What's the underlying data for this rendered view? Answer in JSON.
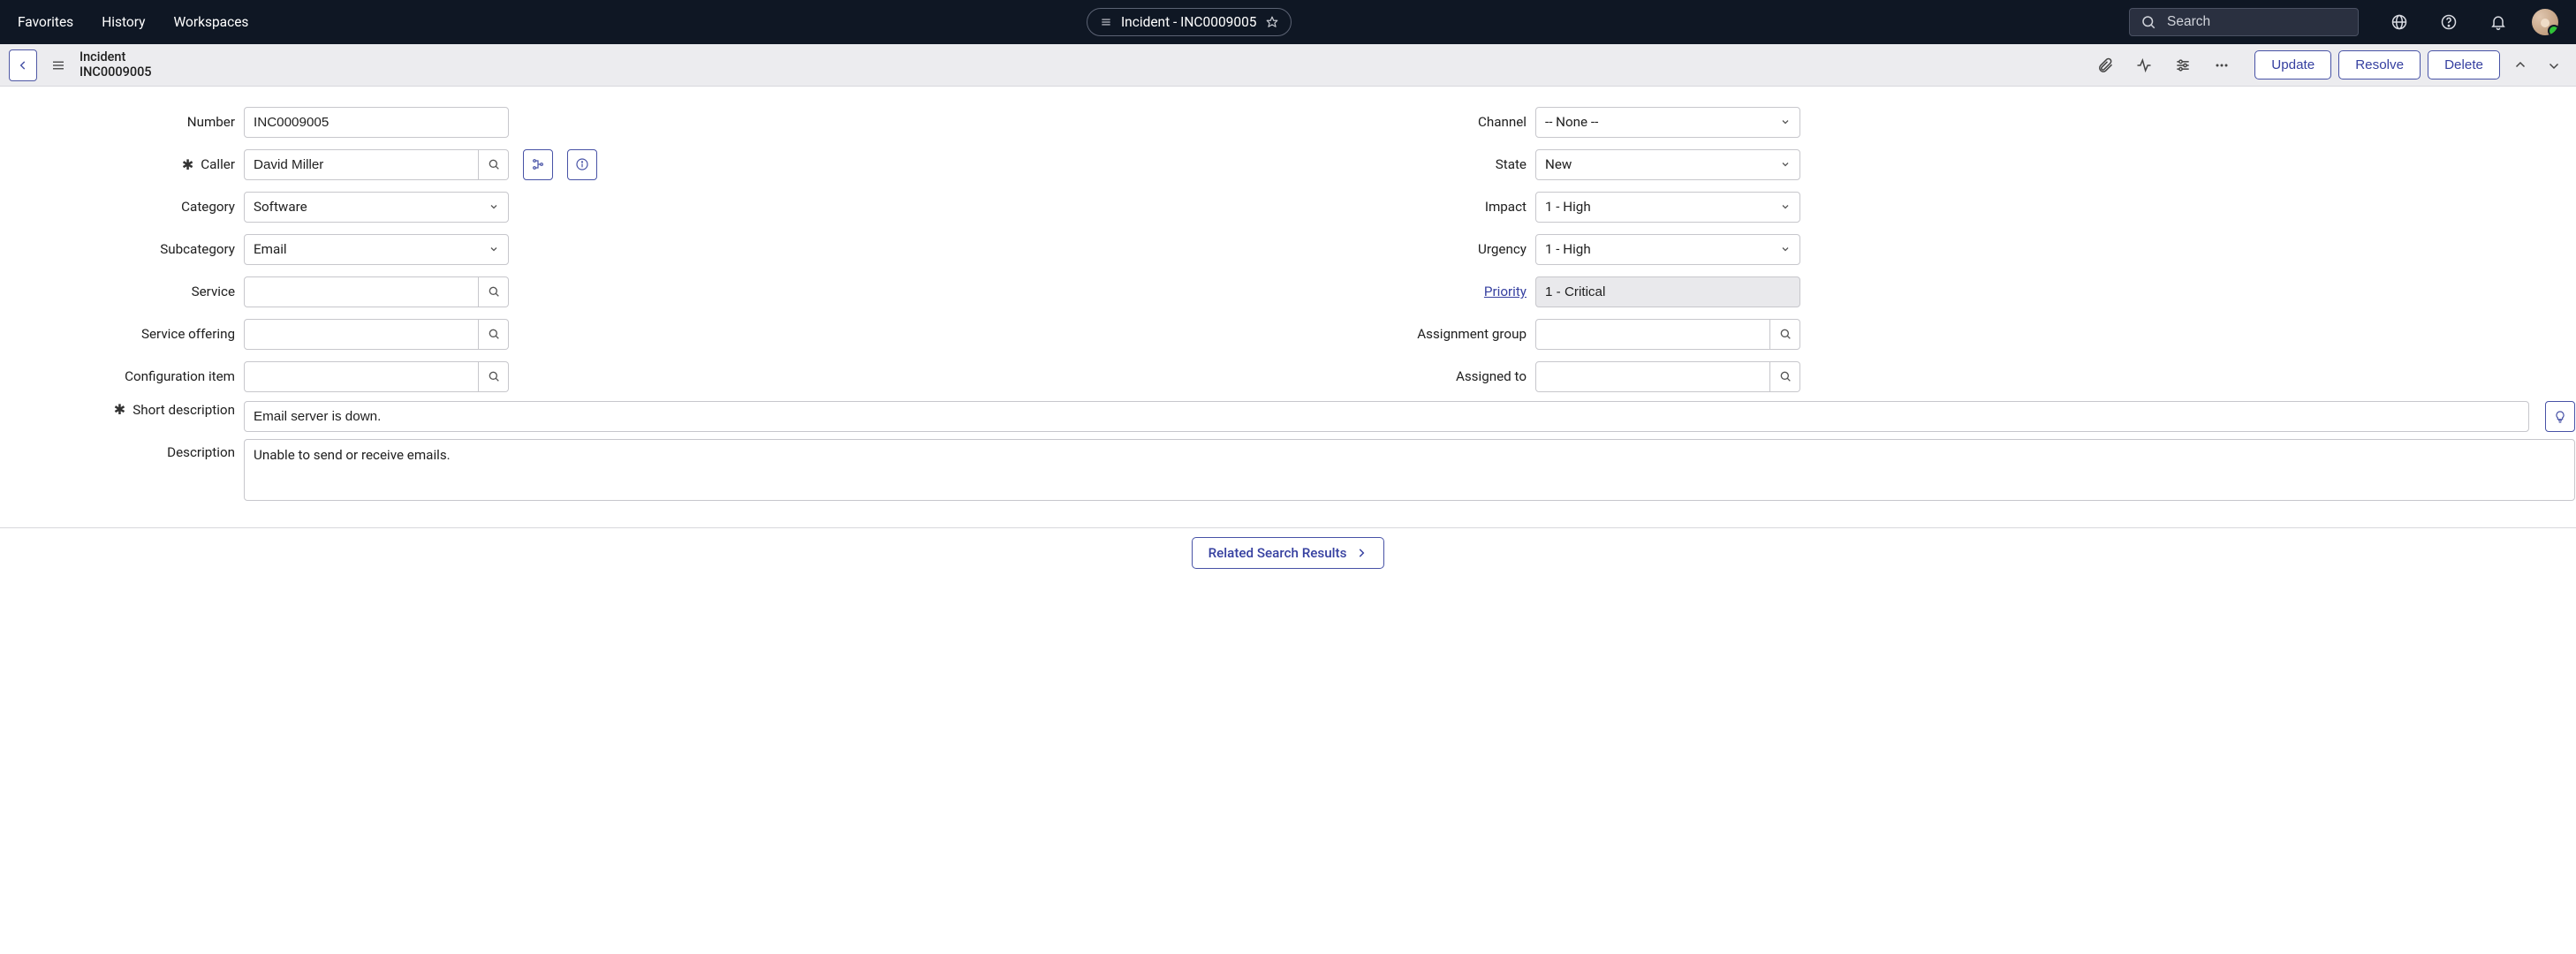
{
  "topnav": {
    "items": [
      "Favorites",
      "History",
      "Workspaces"
    ],
    "title_pill": "Incident - INC0009005",
    "search_placeholder": "Search"
  },
  "subbar": {
    "crumb_type": "Incident",
    "crumb_id": "INC0009005",
    "actions": {
      "update": "Update",
      "resolve": "Resolve",
      "delete": "Delete"
    }
  },
  "form": {
    "labels": {
      "number": "Number",
      "caller": "Caller",
      "category": "Category",
      "subcategory": "Subcategory",
      "service": "Service",
      "service_offering": "Service offering",
      "configuration_item": "Configuration item",
      "channel": "Channel",
      "state": "State",
      "impact": "Impact",
      "urgency": "Urgency",
      "priority": "Priority",
      "assignment_group": "Assignment group",
      "assigned_to": "Assigned to",
      "short_description": "Short description",
      "description": "Description"
    },
    "values": {
      "number": "INC0009005",
      "caller": "David Miller",
      "category": "Software",
      "subcategory": "Email",
      "service": "",
      "service_offering": "",
      "configuration_item": "",
      "channel": "-- None --",
      "state": "New",
      "impact": "1 - High",
      "urgency": "1 - High",
      "priority": "1 - Critical",
      "assignment_group": "",
      "assigned_to": "",
      "short_description": "Email server is down.",
      "description": "Unable to send or receive emails."
    }
  },
  "bottom": {
    "related": "Related Search Results"
  }
}
